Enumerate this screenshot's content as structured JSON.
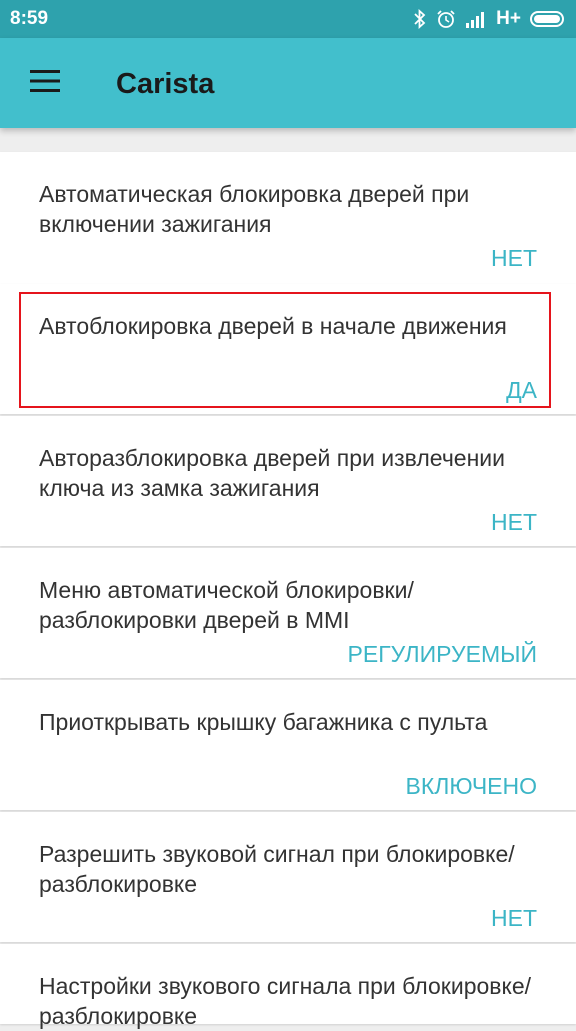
{
  "status_bar": {
    "time": "8:59",
    "network_label": "H+",
    "icons": [
      "bluetooth-icon",
      "alarm-icon",
      "signal-icon",
      "battery-icon"
    ]
  },
  "app_bar": {
    "title": "Carista",
    "menu_icon": "hamburger-menu-icon"
  },
  "settings": [
    {
      "title": "Автоматическая блокировка дверей при включении зажигания",
      "value": "НЕТ"
    },
    {
      "title": "Автоблокировка дверей в начале движения",
      "value": "ДА"
    },
    {
      "title": "Авторазблокировка дверей при извлечении ключа из замка зажигания",
      "value": "НЕТ"
    },
    {
      "title": "Меню автоматической блокировки/ разблокировки дверей в MMI",
      "value": "РЕГУЛИРУЕМЫЙ"
    },
    {
      "title": "Приоткрывать крышку багажника с пульта",
      "value": "ВКЛЮЧЕНО"
    },
    {
      "title": "Разрешить звуковой сигнал при блокировке/разблокировке",
      "value": "НЕТ"
    },
    {
      "title": "Настройки звукового сигнала при блокировке/разблокировке",
      "value": ""
    }
  ],
  "colors": {
    "status_bar": "#2ea2ad",
    "app_bar": "#42bfcc",
    "value_accent": "#3cb5c6",
    "highlight": "#e5141c",
    "background": "#eeeeee"
  }
}
